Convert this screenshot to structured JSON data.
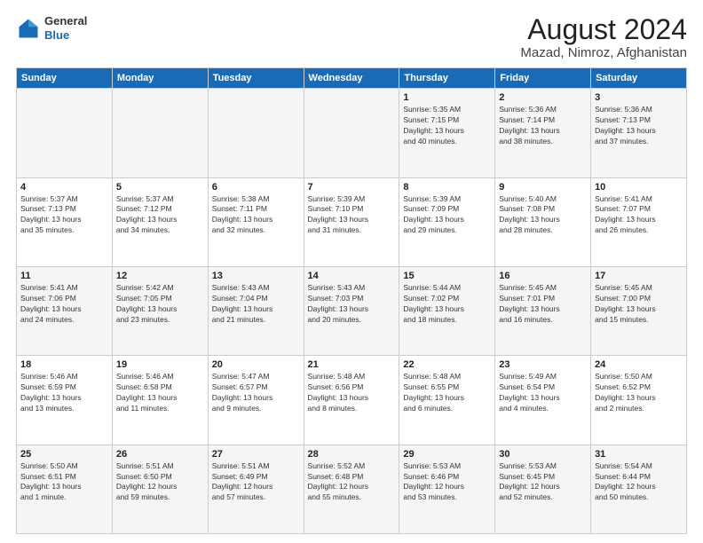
{
  "header": {
    "logo_line1": "General",
    "logo_line2": "Blue",
    "month": "August 2024",
    "location": "Mazad, Nimroz, Afghanistan"
  },
  "weekdays": [
    "Sunday",
    "Monday",
    "Tuesday",
    "Wednesday",
    "Thursday",
    "Friday",
    "Saturday"
  ],
  "weeks": [
    [
      {
        "day": "",
        "info": ""
      },
      {
        "day": "",
        "info": ""
      },
      {
        "day": "",
        "info": ""
      },
      {
        "day": "",
        "info": ""
      },
      {
        "day": "1",
        "info": "Sunrise: 5:35 AM\nSunset: 7:15 PM\nDaylight: 13 hours\nand 40 minutes."
      },
      {
        "day": "2",
        "info": "Sunrise: 5:36 AM\nSunset: 7:14 PM\nDaylight: 13 hours\nand 38 minutes."
      },
      {
        "day": "3",
        "info": "Sunrise: 5:36 AM\nSunset: 7:13 PM\nDaylight: 13 hours\nand 37 minutes."
      }
    ],
    [
      {
        "day": "4",
        "info": "Sunrise: 5:37 AM\nSunset: 7:13 PM\nDaylight: 13 hours\nand 35 minutes."
      },
      {
        "day": "5",
        "info": "Sunrise: 5:37 AM\nSunset: 7:12 PM\nDaylight: 13 hours\nand 34 minutes."
      },
      {
        "day": "6",
        "info": "Sunrise: 5:38 AM\nSunset: 7:11 PM\nDaylight: 13 hours\nand 32 minutes."
      },
      {
        "day": "7",
        "info": "Sunrise: 5:39 AM\nSunset: 7:10 PM\nDaylight: 13 hours\nand 31 minutes."
      },
      {
        "day": "8",
        "info": "Sunrise: 5:39 AM\nSunset: 7:09 PM\nDaylight: 13 hours\nand 29 minutes."
      },
      {
        "day": "9",
        "info": "Sunrise: 5:40 AM\nSunset: 7:08 PM\nDaylight: 13 hours\nand 28 minutes."
      },
      {
        "day": "10",
        "info": "Sunrise: 5:41 AM\nSunset: 7:07 PM\nDaylight: 13 hours\nand 26 minutes."
      }
    ],
    [
      {
        "day": "11",
        "info": "Sunrise: 5:41 AM\nSunset: 7:06 PM\nDaylight: 13 hours\nand 24 minutes."
      },
      {
        "day": "12",
        "info": "Sunrise: 5:42 AM\nSunset: 7:05 PM\nDaylight: 13 hours\nand 23 minutes."
      },
      {
        "day": "13",
        "info": "Sunrise: 5:43 AM\nSunset: 7:04 PM\nDaylight: 13 hours\nand 21 minutes."
      },
      {
        "day": "14",
        "info": "Sunrise: 5:43 AM\nSunset: 7:03 PM\nDaylight: 13 hours\nand 20 minutes."
      },
      {
        "day": "15",
        "info": "Sunrise: 5:44 AM\nSunset: 7:02 PM\nDaylight: 13 hours\nand 18 minutes."
      },
      {
        "day": "16",
        "info": "Sunrise: 5:45 AM\nSunset: 7:01 PM\nDaylight: 13 hours\nand 16 minutes."
      },
      {
        "day": "17",
        "info": "Sunrise: 5:45 AM\nSunset: 7:00 PM\nDaylight: 13 hours\nand 15 minutes."
      }
    ],
    [
      {
        "day": "18",
        "info": "Sunrise: 5:46 AM\nSunset: 6:59 PM\nDaylight: 13 hours\nand 13 minutes."
      },
      {
        "day": "19",
        "info": "Sunrise: 5:46 AM\nSunset: 6:58 PM\nDaylight: 13 hours\nand 11 minutes."
      },
      {
        "day": "20",
        "info": "Sunrise: 5:47 AM\nSunset: 6:57 PM\nDaylight: 13 hours\nand 9 minutes."
      },
      {
        "day": "21",
        "info": "Sunrise: 5:48 AM\nSunset: 6:56 PM\nDaylight: 13 hours\nand 8 minutes."
      },
      {
        "day": "22",
        "info": "Sunrise: 5:48 AM\nSunset: 6:55 PM\nDaylight: 13 hours\nand 6 minutes."
      },
      {
        "day": "23",
        "info": "Sunrise: 5:49 AM\nSunset: 6:54 PM\nDaylight: 13 hours\nand 4 minutes."
      },
      {
        "day": "24",
        "info": "Sunrise: 5:50 AM\nSunset: 6:52 PM\nDaylight: 13 hours\nand 2 minutes."
      }
    ],
    [
      {
        "day": "25",
        "info": "Sunrise: 5:50 AM\nSunset: 6:51 PM\nDaylight: 13 hours\nand 1 minute."
      },
      {
        "day": "26",
        "info": "Sunrise: 5:51 AM\nSunset: 6:50 PM\nDaylight: 12 hours\nand 59 minutes."
      },
      {
        "day": "27",
        "info": "Sunrise: 5:51 AM\nSunset: 6:49 PM\nDaylight: 12 hours\nand 57 minutes."
      },
      {
        "day": "28",
        "info": "Sunrise: 5:52 AM\nSunset: 6:48 PM\nDaylight: 12 hours\nand 55 minutes."
      },
      {
        "day": "29",
        "info": "Sunrise: 5:53 AM\nSunset: 6:46 PM\nDaylight: 12 hours\nand 53 minutes."
      },
      {
        "day": "30",
        "info": "Sunrise: 5:53 AM\nSunset: 6:45 PM\nDaylight: 12 hours\nand 52 minutes."
      },
      {
        "day": "31",
        "info": "Sunrise: 5:54 AM\nSunset: 6:44 PM\nDaylight: 12 hours\nand 50 minutes."
      }
    ]
  ]
}
